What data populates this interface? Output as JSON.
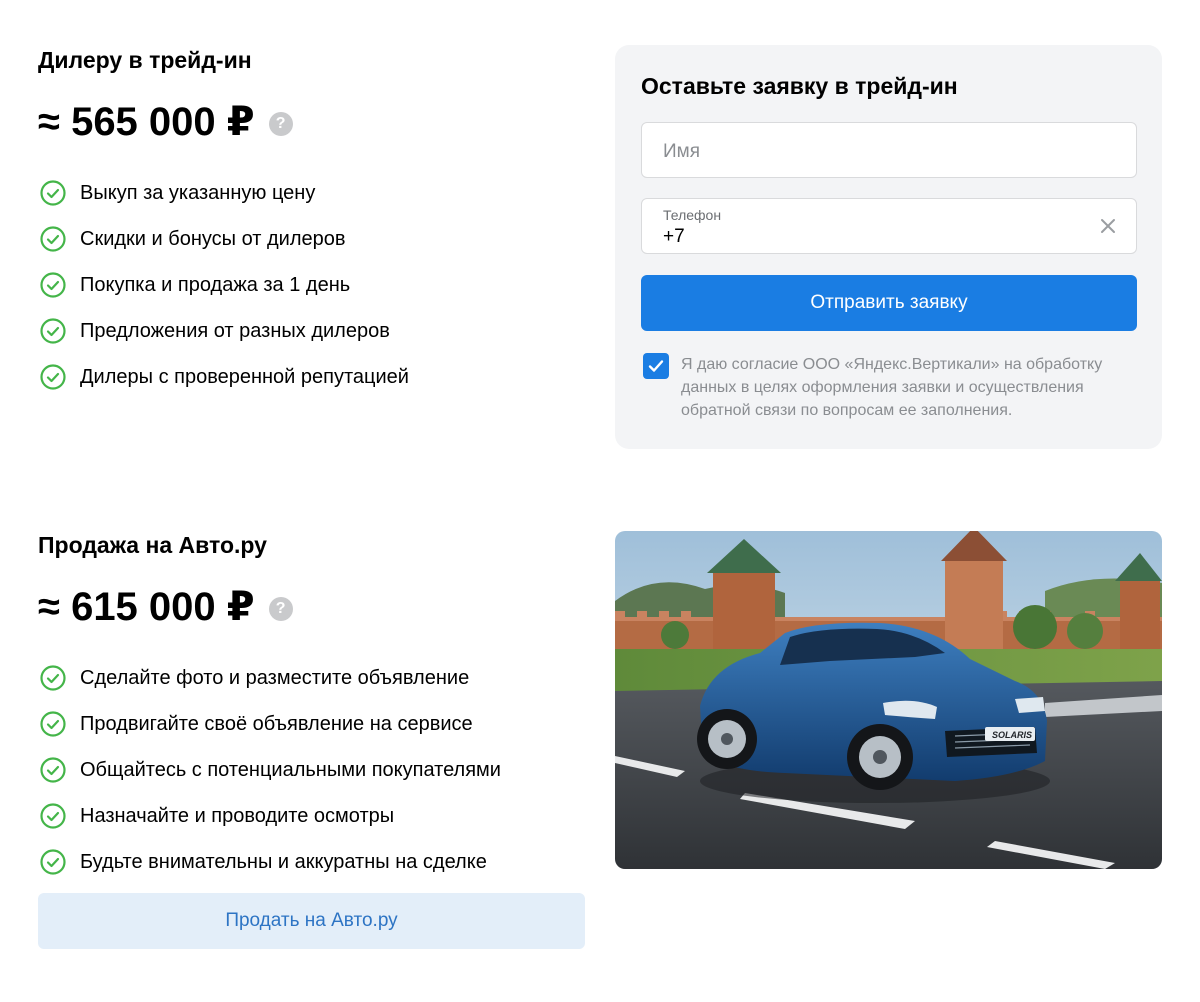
{
  "dealer": {
    "title": "Дилеру в трейд-ин",
    "price": "≈ 565 000 ₽",
    "help": "?",
    "features": [
      "Выкуп за указанную цену",
      "Скидки и бонусы от дилеров",
      "Покупка и продажа за 1 день",
      "Предложения от разных дилеров",
      "Дилеры с проверенной репутацией"
    ]
  },
  "form": {
    "title": "Оставьте заявку в трейд-ин",
    "name_placeholder": "Имя",
    "phone_label": "Телефон",
    "phone_value": "+7",
    "submit_label": "Отправить заявку",
    "consent_checked": true,
    "consent_text": "Я даю согласие ООО «Яндекс.Вертикали» на обработку данных в целях оформления заявки и осуществления обратной связи по вопросам ее заполнения."
  },
  "autoru": {
    "title": "Продажа на Авто.ру",
    "price": "≈ 615 000 ₽",
    "help": "?",
    "features": [
      "Сделайте фото и разместите объявление",
      "Продвигайте своё объявление на сервисе",
      "Общайтесь с потенциальными покупателями",
      "Назначайте и проводите осмотры",
      "Будьте внимательны и аккуратны на сделке"
    ],
    "sell_label": "Продать на Авто.ру"
  },
  "image": {
    "plate_text": "SOLARIS"
  },
  "colors": {
    "accent": "#1a7de3",
    "check_green": "#44b549",
    "card_bg": "#f3f4f6",
    "secondary_button_bg": "#e3eef9",
    "secondary_button_text": "#2d74c4"
  },
  "icons": {
    "feature": "check-circle-icon",
    "help": "question-circle-icon",
    "clear": "close-icon",
    "checkbox": "checkmark-icon"
  }
}
